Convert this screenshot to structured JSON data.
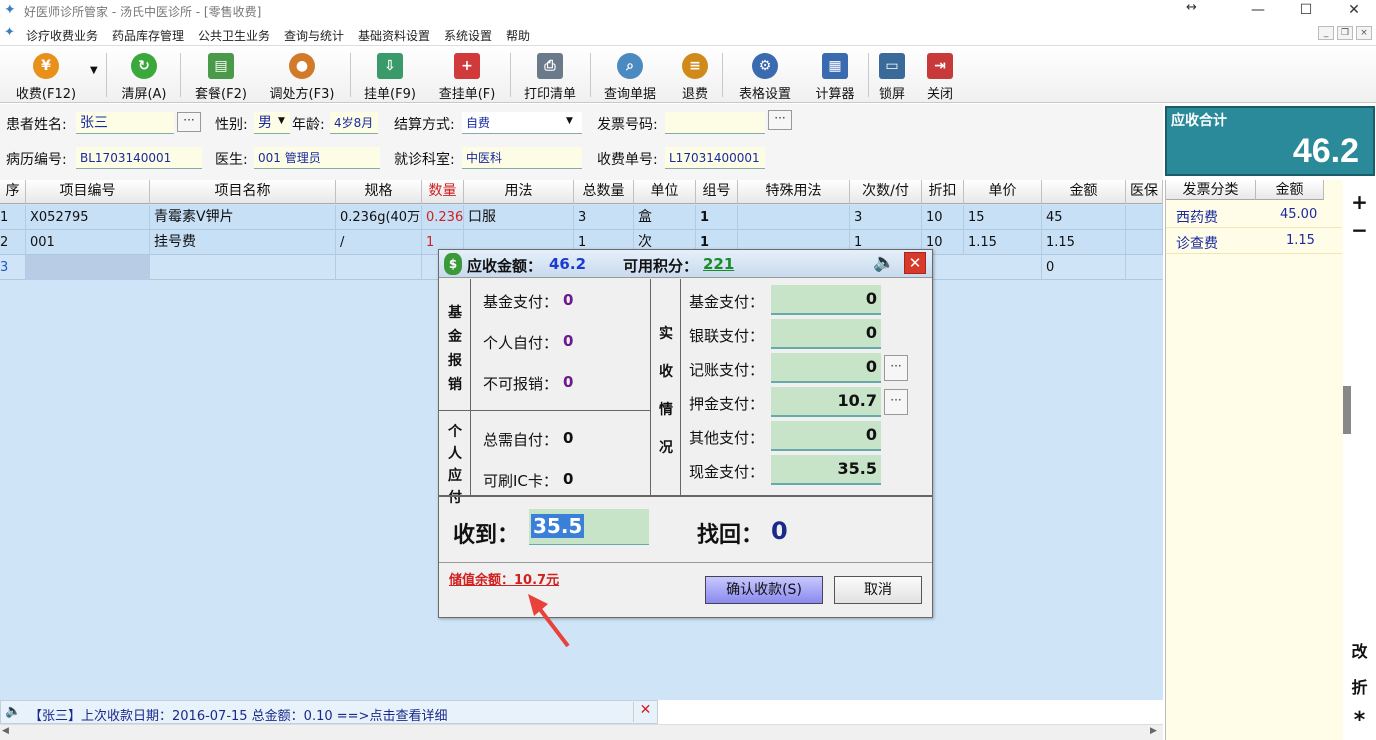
{
  "window": {
    "title": "好医师诊所管家 - 汤氏中医诊所 - [零售收费]"
  },
  "menu": [
    "诊疗收费业务",
    "药品库存管理",
    "公共卫生业务",
    "查询与统计",
    "基础资料设置",
    "系统设置",
    "帮助"
  ],
  "toolbar": [
    "收费(F12)",
    "清屏(A)",
    "套餐(F2)",
    "调处方(F3)",
    "挂单(F9)",
    "查挂单(F)",
    "打印清单",
    "查询单据",
    "退费",
    "表格设置",
    "计算器",
    "锁屏",
    "关闭"
  ],
  "form": {
    "patient_name_label": "患者姓名:",
    "patient_name": "张三",
    "gender_label": "性别:",
    "gender": "男",
    "age_label": "年龄:",
    "age": "4岁8月",
    "settle_label": "结算方式:",
    "settle": "自费",
    "invoice_label": "发票号码:",
    "invoice": "",
    "record_label": "病历编号:",
    "record": "BL1703140001",
    "doctor_label": "医生:",
    "doctor": "001 管理员",
    "dept_label": "就诊科室:",
    "dept": "中医科",
    "charge_label": "收费单号:",
    "charge_no": "L17031400001"
  },
  "total": {
    "label": "应收合计",
    "value": "46.2"
  },
  "grid": {
    "headers": [
      "序",
      "项目编号",
      "项目名称",
      "规格",
      "数量",
      "用法",
      "总数量",
      "单位",
      "组号",
      "特殊用法",
      "次数/付",
      "折扣",
      "单价",
      "金额",
      "医保"
    ],
    "rows": [
      [
        "1",
        "X052795",
        "青霉素V钾片",
        "0.236g(40万",
        "0.236",
        "口服",
        "3",
        "盒",
        "1",
        "",
        "3",
        "10",
        "15",
        "45",
        ""
      ],
      [
        "2",
        "001",
        "挂号费",
        "/",
        "1",
        "",
        "1",
        "次",
        "1",
        "",
        "1",
        "10",
        "1.15",
        "1.15",
        ""
      ],
      [
        "3",
        "",
        "",
        "",
        "",
        "",
        "",
        "",
        "",
        "",
        "",
        "",
        "",
        "0",
        ""
      ]
    ]
  },
  "invoice_panel": {
    "headers": [
      "发票分类",
      "金额"
    ],
    "rows": [
      [
        "西药费",
        "45.00"
      ],
      [
        "诊查费",
        "1.15"
      ]
    ]
  },
  "sidebar": [
    "+",
    "−",
    "改",
    "折",
    "*"
  ],
  "status": {
    "text": "【张三】上次收款日期：2016-07-15 总金额：0.10 ==>点击查看详细"
  },
  "dialog": {
    "due_label": "应收金额：",
    "due": "46.2",
    "points_label": "可用积分：",
    "points": "221",
    "fund_title": "基金报销",
    "fund_pay_label": "基金支付：",
    "fund_pay": "0",
    "self_pay_label": "个人自付：",
    "self_pay": "0",
    "non_reimb_label": "不可报销：",
    "non_reimb": "0",
    "personal_title": "个人应付",
    "total_self_label": "总需自付：",
    "total_self": "0",
    "ic_label": "可刷IC卡：",
    "ic": "0",
    "actual_title": "实收情况",
    "payments": [
      {
        "label": "基金支付：",
        "value": "0"
      },
      {
        "label": "银联支付：",
        "value": "0"
      },
      {
        "label": "记账支付：",
        "value": "0"
      },
      {
        "label": "押金支付：",
        "value": "10.7"
      },
      {
        "label": "其他支付：",
        "value": "0"
      },
      {
        "label": "现金支付：",
        "value": "35.5"
      }
    ],
    "received_label": "收到：",
    "received": "35.5",
    "change_label": "找回：",
    "change": "0",
    "balance": "储值余额：10.7元",
    "confirm": "确认收款(S)",
    "cancel": "取消"
  },
  "colors": {
    "accent": "#2a8a9a",
    "grid_bg": "#cfe5f7",
    "pay_field": "#c8e4c8",
    "arrow": "#e8423a"
  }
}
